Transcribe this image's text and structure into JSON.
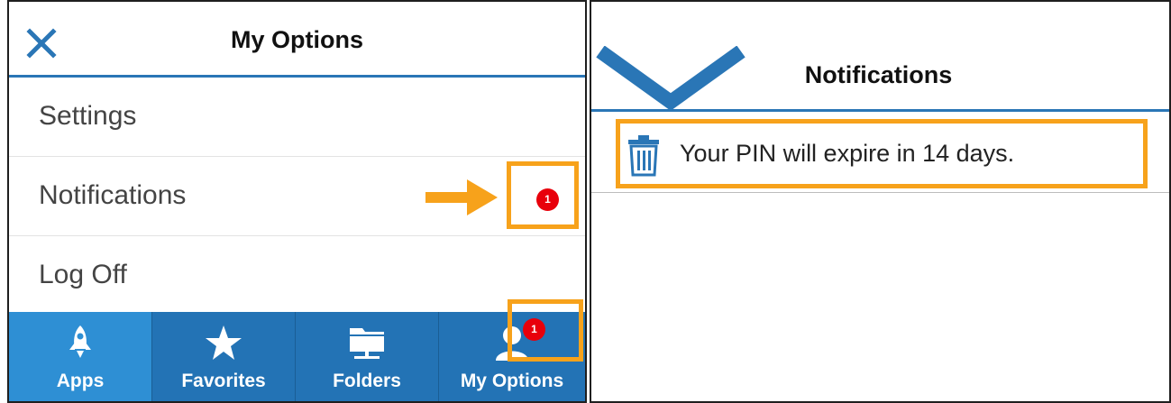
{
  "colors": {
    "accent": "#2a76b6",
    "tabbar": "#2373b5",
    "tab_active": "#2e8fd4",
    "callout": "#f7a21b",
    "badge": "#e8000b"
  },
  "left": {
    "header": {
      "title": "My Options",
      "close_icon": "close-icon"
    },
    "menu": {
      "items": [
        {
          "label": "Settings"
        },
        {
          "label": "Notifications",
          "badge_count": "1"
        },
        {
          "label": "Log Off"
        }
      ]
    },
    "tabbar": {
      "tabs": [
        {
          "label": "Apps",
          "icon": "rocket-icon"
        },
        {
          "label": "Favorites",
          "icon": "star-icon"
        },
        {
          "label": "Folders",
          "icon": "folder-icon"
        },
        {
          "label": "My Options",
          "icon": "user-icon",
          "badge_count": "1"
        }
      ]
    }
  },
  "right": {
    "header": {
      "title": "Notifications",
      "back_icon": "chevron-down-icon"
    },
    "notifications": [
      {
        "text": "Your PIN will expire in 14 days.",
        "icon": "trash-icon"
      }
    ]
  }
}
